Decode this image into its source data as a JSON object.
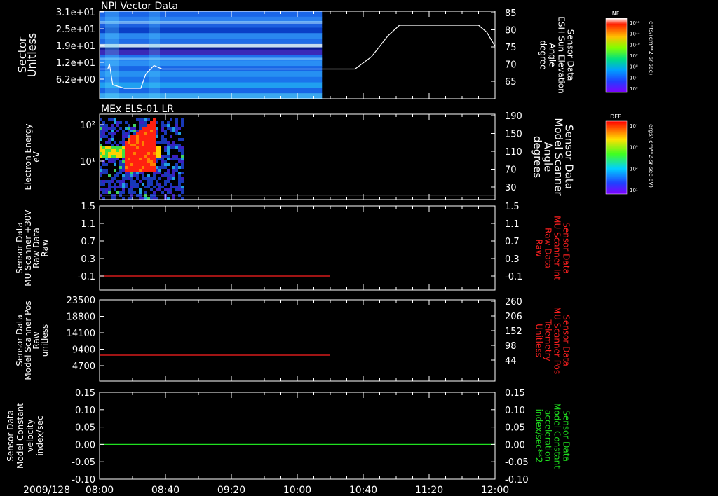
{
  "date_label": "2009/128",
  "x_ticks": [
    "08:00",
    "08:40",
    "09:20",
    "10:00",
    "10:40",
    "11:20",
    "12:00"
  ],
  "colors": {
    "white": "#ffffff",
    "red": "#ff2020",
    "green": "#20e020"
  },
  "colorbars": [
    {
      "tag": "NF",
      "unit": "cnts/(cm**2-sr-sec)",
      "ticks": [
        "10¹²",
        "10¹¹",
        "10¹⁰",
        "10⁹",
        "10⁸",
        "10⁷",
        "10⁶"
      ]
    },
    {
      "tag": "DEF",
      "unit": "ergs/(cm**2-sr-sec-eV)",
      "ticks": [
        "10⁴",
        "10³",
        "10²",
        "10¹"
      ]
    }
  ],
  "chart_data": [
    {
      "type": "heatmap",
      "title": "NPI Vector Data",
      "left_label": [
        "Sector",
        "Unitless"
      ],
      "left_ticks": [
        "3.1e+01",
        "2.5e+01",
        "1.9e+01",
        "1.2e+01",
        "6.2e+00"
      ],
      "right_label": [
        "Sensor Data",
        "ESH Sun Elevation",
        "Angle",
        "degree"
      ],
      "right_ticks": [
        "85",
        "80",
        "75",
        "70",
        "65"
      ],
      "right_ylim": [
        60,
        85
      ],
      "data_extent": [
        "08:00",
        "10:15"
      ],
      "overlay_line": {
        "axis": "right",
        "color": "white",
        "points": [
          [
            "08:00",
            68.5
          ],
          [
            "08:05",
            68.5
          ],
          [
            "08:06",
            70
          ],
          [
            "08:08",
            64
          ],
          [
            "08:15",
            63
          ],
          [
            "08:25",
            63
          ],
          [
            "08:28",
            67
          ],
          [
            "08:33",
            69.5
          ],
          [
            "08:38",
            68.5
          ],
          [
            "09:00",
            68.5
          ],
          [
            "10:35",
            68.5
          ],
          [
            "10:45",
            72
          ],
          [
            "10:55",
            78
          ],
          [
            "11:02",
            81
          ],
          [
            "11:10",
            81
          ],
          [
            "11:50",
            81
          ],
          [
            "11:55",
            79
          ],
          [
            "12:00",
            75
          ]
        ]
      }
    },
    {
      "type": "heatmap",
      "title": "MEx ELS-01 LR",
      "left_label": [
        "Electron Energy",
        "eV"
      ],
      "left_ticks": [
        "10²",
        "10¹"
      ],
      "right_label": [
        "Sensor Data",
        "Model Scanner",
        "Angle",
        "degrees"
      ],
      "right_ticks": [
        "190",
        "150",
        "110",
        "70",
        "30"
      ],
      "right_ylim": [
        0,
        190
      ],
      "data_extent": [
        "08:00",
        "08:50"
      ],
      "overlay_line": {
        "axis": "right",
        "color": "white",
        "points": [
          [
            "08:00",
            10
          ],
          [
            "12:00",
            10
          ]
        ]
      }
    },
    {
      "type": "line",
      "left_label": [
        "Sensor Data",
        "MU Scanner +30V",
        "Raw Data",
        "Raw"
      ],
      "left_ticks": [
        "1.5",
        "1.1",
        "0.7",
        "0.3",
        "-0.1"
      ],
      "right_label": [
        "Sensor Data",
        "MU Scanner Int",
        "Raw Data",
        "Raw"
      ],
      "right_label_color": "red",
      "right_ticks": [
        "1.5",
        "1.1",
        "0.7",
        "0.3",
        "-0.1"
      ],
      "ylim": [
        -0.3,
        1.5
      ],
      "series": [
        {
          "color": "red",
          "points": [
            [
              "08:00",
              0.0
            ],
            [
              "10:20",
              0.0
            ]
          ]
        }
      ]
    },
    {
      "type": "line",
      "left_label": [
        "Sensor Data",
        "Model Scanner Pos",
        "Raw",
        "unitless"
      ],
      "left_ticks": [
        "23500",
        "18800",
        "14100",
        "9400",
        "4700"
      ],
      "right_label": [
        "Sensor Data",
        "MU Scanner Pos",
        "Telemetry",
        "Unitless"
      ],
      "right_label_color": "red",
      "right_ticks": [
        "260",
        "206",
        "152",
        "98",
        "44"
      ],
      "ylim": [
        0,
        23500
      ],
      "series": [
        {
          "color": "red",
          "points": [
            [
              "08:00",
              7500
            ],
            [
              "10:20",
              7500
            ]
          ]
        }
      ]
    },
    {
      "type": "line",
      "left_label": [
        "Sensor Data",
        "Model Constant",
        "velocity",
        "index/sec"
      ],
      "left_ticks": [
        "0.15",
        "0.10",
        "0.05",
        "0.00",
        "-0.05",
        "-0.10"
      ],
      "right_label": [
        "Sensor Data",
        "Model Constant",
        "acceleration",
        "index/sec**2"
      ],
      "right_label_color": "green",
      "right_ticks": [
        "0.15",
        "0.10",
        "0.05",
        "0.00",
        "-0.05",
        "-0.10"
      ],
      "ylim": [
        -0.1,
        0.15
      ],
      "series": [
        {
          "color": "green",
          "points": [
            [
              "08:00",
              0.0
            ],
            [
              "12:00",
              0.0
            ]
          ]
        }
      ]
    }
  ]
}
